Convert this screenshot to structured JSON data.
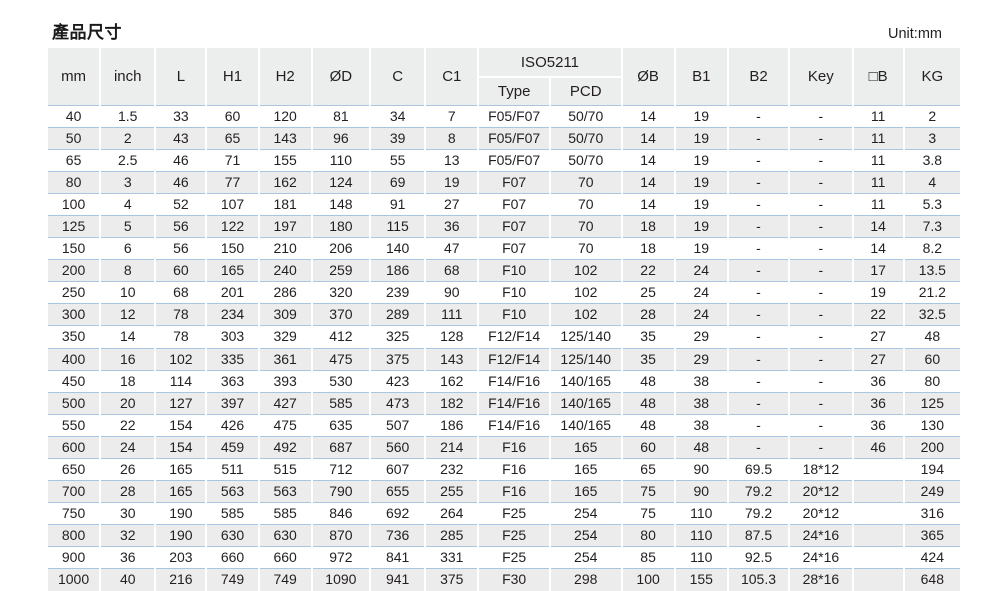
{
  "header": {
    "title": "產品尺寸",
    "unit_label": "Unit:mm"
  },
  "table": {
    "columns": [
      {
        "key": "mm",
        "label": "mm"
      },
      {
        "key": "inch",
        "label": "inch"
      },
      {
        "key": "L",
        "label": "L"
      },
      {
        "key": "H1",
        "label": "H1"
      },
      {
        "key": "H2",
        "label": "H2"
      },
      {
        "key": "OD",
        "label": "ØD"
      },
      {
        "key": "C",
        "label": "C"
      },
      {
        "key": "C1",
        "label": "C1"
      },
      {
        "key": "type",
        "label": "Type"
      },
      {
        "key": "pcd",
        "label": "PCD"
      },
      {
        "key": "OB",
        "label": "ØB"
      },
      {
        "key": "B1",
        "label": "B1"
      },
      {
        "key": "B2",
        "label": "B2"
      },
      {
        "key": "Key",
        "label": "Key"
      },
      {
        "key": "sqB",
        "label": "□B"
      },
      {
        "key": "KG",
        "label": "KG"
      }
    ],
    "group_header": {
      "iso": "ISO5211"
    },
    "rows": [
      [
        "40",
        "1.5",
        "33",
        "60",
        "120",
        "81",
        "34",
        "7",
        "F05/F07",
        "50/70",
        "14",
        "19",
        "-",
        "-",
        "11",
        "2"
      ],
      [
        "50",
        "2",
        "43",
        "65",
        "143",
        "96",
        "39",
        "8",
        "F05/F07",
        "50/70",
        "14",
        "19",
        "-",
        "-",
        "11",
        "3"
      ],
      [
        "65",
        "2.5",
        "46",
        "71",
        "155",
        "110",
        "55",
        "13",
        "F05/F07",
        "50/70",
        "14",
        "19",
        "-",
        "-",
        "11",
        "3.8"
      ],
      [
        "80",
        "3",
        "46",
        "77",
        "162",
        "124",
        "69",
        "19",
        "F07",
        "70",
        "14",
        "19",
        "-",
        "-",
        "11",
        "4"
      ],
      [
        "100",
        "4",
        "52",
        "107",
        "181",
        "148",
        "91",
        "27",
        "F07",
        "70",
        "14",
        "19",
        "-",
        "-",
        "11",
        "5.3"
      ],
      [
        "125",
        "5",
        "56",
        "122",
        "197",
        "180",
        "115",
        "36",
        "F07",
        "70",
        "18",
        "19",
        "-",
        "-",
        "14",
        "7.3"
      ],
      [
        "150",
        "6",
        "56",
        "150",
        "210",
        "206",
        "140",
        "47",
        "F07",
        "70",
        "18",
        "19",
        "-",
        "-",
        "14",
        "8.2"
      ],
      [
        "200",
        "8",
        "60",
        "165",
        "240",
        "259",
        "186",
        "68",
        "F10",
        "102",
        "22",
        "24",
        "-",
        "-",
        "17",
        "13.5"
      ],
      [
        "250",
        "10",
        "68",
        "201",
        "286",
        "320",
        "239",
        "90",
        "F10",
        "102",
        "25",
        "24",
        "-",
        "-",
        "19",
        "21.2"
      ],
      [
        "300",
        "12",
        "78",
        "234",
        "309",
        "370",
        "289",
        "111",
        "F10",
        "102",
        "28",
        "24",
        "-",
        "-",
        "22",
        "32.5"
      ],
      [
        "350",
        "14",
        "78",
        "303",
        "329",
        "412",
        "325",
        "128",
        "F12/F14",
        "125/140",
        "35",
        "29",
        "-",
        "-",
        "27",
        "48"
      ],
      [
        "400",
        "16",
        "102",
        "335",
        "361",
        "475",
        "375",
        "143",
        "F12/F14",
        "125/140",
        "35",
        "29",
        "-",
        "-",
        "27",
        "60"
      ],
      [
        "450",
        "18",
        "114",
        "363",
        "393",
        "530",
        "423",
        "162",
        "F14/F16",
        "140/165",
        "48",
        "38",
        "-",
        "-",
        "36",
        "80"
      ],
      [
        "500",
        "20",
        "127",
        "397",
        "427",
        "585",
        "473",
        "182",
        "F14/F16",
        "140/165",
        "48",
        "38",
        "-",
        "-",
        "36",
        "125"
      ],
      [
        "550",
        "22",
        "154",
        "426",
        "475",
        "635",
        "507",
        "186",
        "F14/F16",
        "140/165",
        "48",
        "38",
        "-",
        "-",
        "36",
        "130"
      ],
      [
        "600",
        "24",
        "154",
        "459",
        "492",
        "687",
        "560",
        "214",
        "F16",
        "165",
        "60",
        "48",
        "-",
        "-",
        "46",
        "200"
      ],
      [
        "650",
        "26",
        "165",
        "511",
        "515",
        "712",
        "607",
        "232",
        "F16",
        "165",
        "65",
        "90",
        "69.5",
        "18*12",
        "",
        "194"
      ],
      [
        "700",
        "28",
        "165",
        "563",
        "563",
        "790",
        "655",
        "255",
        "F16",
        "165",
        "75",
        "90",
        "79.2",
        "20*12",
        "",
        "249"
      ],
      [
        "750",
        "30",
        "190",
        "585",
        "585",
        "846",
        "692",
        "264",
        "F25",
        "254",
        "75",
        "110",
        "79.2",
        "20*12",
        "",
        "316"
      ],
      [
        "800",
        "32",
        "190",
        "630",
        "630",
        "870",
        "736",
        "285",
        "F25",
        "254",
        "80",
        "110",
        "87.5",
        "24*16",
        "",
        "365"
      ],
      [
        "900",
        "36",
        "203",
        "660",
        "660",
        "972",
        "841",
        "331",
        "F25",
        "254",
        "85",
        "110",
        "92.5",
        "24*16",
        "",
        "424"
      ],
      [
        "1000",
        "40",
        "216",
        "749",
        "749",
        "1090",
        "941",
        "375",
        "F30",
        "298",
        "100",
        "155",
        "105.3",
        "28*16",
        "",
        "648"
      ]
    ]
  },
  "colors": {
    "header_bg": "#eceded",
    "row_alt_bg": "#ececec",
    "rule": "#a8c6df",
    "text": "#231f20"
  }
}
